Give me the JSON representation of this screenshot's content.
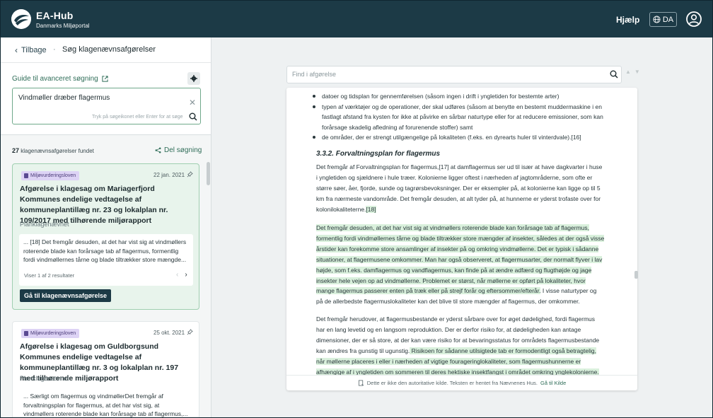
{
  "header": {
    "brand_title": "EA-Hub",
    "brand_subtitle": "Danmarks Miljøportal",
    "help_label": "Hjælp",
    "language_label": "DA"
  },
  "breadcrumb": {
    "back_label": "Tilbage",
    "separator": "·",
    "current": "Søg klagenævnsafgørelser"
  },
  "search": {
    "guide_label": "Guide til avanceret søgning",
    "value": "Vindmøller dræber flagermus",
    "hint": "Tryk på søgeikonet eller Enter for at søge"
  },
  "results": {
    "count": "27",
    "count_label": "klagenævnsafgørelser fundet",
    "share_label": "Del søgning",
    "cards": [
      {
        "tag": "Miljøvurderingsloven",
        "date": "22 jan. 2021",
        "title": "Afgørelse i klagesag om Mariagerfjord Kommunes endelige vedtagelse af kommuneplantillæg nr. 23 og lokalplan nr. 109/2017 med tilhørende miljørapport",
        "source": "Planklagenævnet",
        "snippet": "... [18] Det fremgår desuden, at det har vist sig at vindmøllers roterende blade kan forårsage tab af flagermus, formentlig fordi vindmøllernes tårne og blade tiltrækker store mængde...",
        "result_count": "Viser 1 af 2 resultater",
        "open_label": "Gå til klagenævnsafgørelse"
      },
      {
        "tag": "Miljøvurderingsloven",
        "date": "25 okt. 2021",
        "title": "Afgørelse i klagesag om Guldborgsund Kommunes endelige vedtagelse af kommuneplantillæg nr. 3 og lokalplan nr. 197 med tilhørende miljørapport",
        "source": "Planklagenævnet",
        "snippet": "... Særligt om flagermus og vindmøllerDet fremgår af forvaltningsplan for flagermus, at det har vist sig, at vindmøllers roterende blade kan forårsage tab af flagermus,..."
      }
    ]
  },
  "finder": {
    "placeholder": "Find i afgørelse"
  },
  "document": {
    "bullets": [
      "datoer og tidsplan for gennemførelsen (såsom ingen i drift i yngletiden for bestemte arter)",
      "typen af værktøjer og de operationer, der skal udføres (såsom at benytte en bestemt muddermaskine i en fastlagt afstand fra kysten for ikke at påvirke en sårbar naturtype eller for at reducere emissioner, som kan forårsage skadelig afledning af forurenende stoffer) samt",
      "de områder, der er strengt utilgængelige på lokaliteten (f.eks. en dyrearts huler til vinterdvale).[16]"
    ],
    "section_title": "3.3.2. Forvaltningsplan for flagermus",
    "para1": "Det fremgår af Forvaltningsplan for flagermus,[17] at damflagermus ser ud til især at have dagkvarter i huse i yngletiden og sjældnere i hule træer. Kolonierne ligger oftest i nærheden af jagtområderne, som ofte er større søer, åer, fjorde, sunde og tagrørsbevoksninger. Der er eksempler på, at kolonierne kan ligge op til 5 km fra nærmeste vandområde. Det fremgår desuden, at alt tyder på, at hunnerne er yderst trofaste over for kolonilokaliteterne.",
    "para1_ref": "[18]",
    "para2_highlight": "Det fremgår desuden, at det har vist sig at vindmøllers roterende blade kan forårsage tab af flagermus, formentlig fordi vindmøllernes tårne og blade tiltrækker store mængder af insekter, således at der også visse årstider kan forekomme store ansamlinger af insekter på og omkring vindmøllerne. Det er typisk i sådanne situationer, at flagermusene omkommer. Man har også observeret, at flagermusarter, der normalt flyver i lav højde, som f.eks. damflagermus og vandflagermus, kan finde på at ændre adfærd og flugthøjde og jage insekter hele vejen op ad vindmøllerne. Problemet er størst, når møllerne er opført på lokaliteter, hvor mange flagermus passerer enten på træk eller på strejf forår og eftersommer/efterår.",
    "para2_rest": " I visse naturtyper og på de allerbedste flagermuslokaliteter kan det blive til store mængder af flagermus, der omkommer.",
    "para3": "Det fremgår herudover, at flagermusbestande er yderst sårbare over for øget dødelighed, fordi flagermus har en lang levetid og en langsom reproduktion. Der er derfor risiko for, at dødeligheden kan antage dimensioner, der er så store, at der kan være risiko for at bevaringsstatus for områdets flagermusbestande kan ændres fra gunstig til ugunstig.",
    "para3_highlight": " Risikoen for sådanne utilsigtede tab er formodentligt også betragtelig, når møllerne placeres i eller i nærheden af vigtige fourageringlokaliteter, som flagermushunnerne er afhængige af i yngletiden om sommeren til deres hektiske insektfangst i området omkring ynglekolonierne.",
    "footer_note": "Dette er ikke den autoritative kilde. Teksten er hentet fra Nævnenes Hus.",
    "footer_link": "Gå til Kilde"
  }
}
